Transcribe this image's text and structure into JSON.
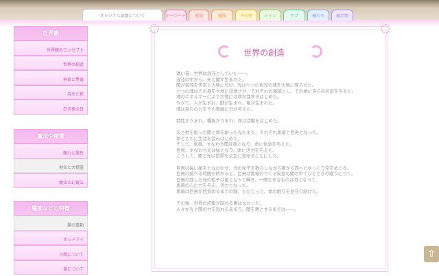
{
  "tabs": [
    {
      "label": "オリジナル部屋について",
      "color": "#cccccc",
      "bg": "#ffffff"
    },
    {
      "label": "キーワード",
      "color": "#f07aa8",
      "bg": "#fde3ee"
    },
    {
      "label": "地域",
      "color": "#ef8a8a",
      "bg": "#fde5e2"
    },
    {
      "label": "種族",
      "color": "#f0a050",
      "bg": "#feeadb"
    },
    {
      "label": "その他",
      "color": "#e8c030",
      "bg": "#fef6d0"
    },
    {
      "label": "メイン",
      "color": "#90d070",
      "bg": "#ebf9e2"
    },
    {
      "label": "サブ",
      "color": "#60c890",
      "bg": "#e3f7ee"
    },
    {
      "label": "俺たち",
      "color": "#80a8f0",
      "bg": "#e6effd"
    },
    {
      "label": "展示物",
      "color": "#a890e0",
      "bg": "#eee8fb"
    }
  ],
  "sidebar": [
    {
      "title": "世界観",
      "items": [
        {
          "label": "世界観のコンセプト"
        },
        {
          "label": "世界の創造"
        },
        {
          "label": "神官と黒竜"
        },
        {
          "label": "月光と影"
        },
        {
          "label": "白き夜の日"
        }
      ]
    },
    {
      "title": "魔法や精霊",
      "items": [
        {
          "label": "魔力と属性"
        },
        {
          "label": "地名と大精霊",
          "active": true
        },
        {
          "label": "魔法と幻竜法"
        }
      ]
    },
    {
      "title": "種族などの特徴",
      "items": [
        {
          "label": "翼の重動",
          "active": true
        },
        {
          "label": "オッドアイ"
        },
        {
          "label": "人間について"
        },
        {
          "label": "竜について"
        }
      ]
    }
  ],
  "main": {
    "title": "世界の創造",
    "paragraphs": [
      "遠い昔、世界は混沌としていた――。\n混沌の中から、光と闇が生まれた。\n闇が混沌を天空と大地に分け、光は七つの色光の魂を大地に降らせた。\n七つの魂はその身を大地に浸透させ、それぞれの領域とし、その地に自らの名前を与えた。\n魂のエネルギーにより大地には命が芽吹きはじめた。\nやがて、人が生まれ、獣が生まれ、竜が生まれた。\n魂は自らの力をその眷属に分け与えた。",
      "特性がうまれ、種族がうまれ、命は活動をはじめた。",
      "天と地を創った闇と命を創った光もまた、それぞれ黒竜と巨鳥となって、\n命とともに生活を営みはじめた。\nそして、黒竜、すなわち闇は夜となり、命に休息を与えた。\n巨鳥、すなわち光は昼となり、命に活力を与えた。\nこうして、闇と光は世界を交互に見守ることにした。",
      "巨鳥は長い尾をたなびかせ、光の粒子を散らしながら東から西へとゆっくり空をめぐる。\n巨鳥の統べる時間が終わると、巨鳥は黒竜のつくる安息の闇の中でひとときの眠りにつく。\n巨鳥の残した光の粒子は星となって輝き、一際大きなものは月となって、\n黒竜の心に力を与え、活力となった。\n黒竜は巨鳥が目覚めるまでの間、ただじっと、命の眠りを見守り続けた。",
      "その後、世界の均衡が崩れる事はなかった。\n人々が光と闇の力を恐れるあまり、闇を悪とするまでは――。"
    ]
  },
  "scroll_top": {
    "icon": "arrow-up-icon"
  }
}
